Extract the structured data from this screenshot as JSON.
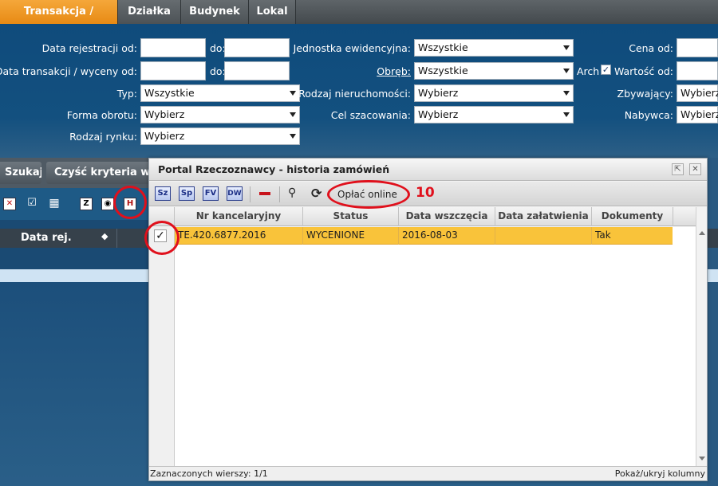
{
  "tabs": [
    {
      "label": "Transakcja / Wycena",
      "active": true
    },
    {
      "label": "Działka",
      "active": false
    },
    {
      "label": "Budynek",
      "active": false
    },
    {
      "label": "Lokal",
      "active": false
    }
  ],
  "filters": {
    "data_rej_od": "Data rejestracji od:",
    "do1": "do:",
    "data_trans_od": "Data transakcji / wyceny od:",
    "do2": "do:",
    "typ": "Typ:",
    "typ_value": "Wszystkie",
    "forma_obrotu": "Forma obrotu:",
    "forma_obrotu_value": "Wybierz",
    "rodzaj_rynku": "Rodzaj rynku:",
    "rodzaj_rynku_value": "Wybierz",
    "jednostka": "Jednostka ewidencyjna:",
    "jednostka_value": "Wszystkie",
    "obreb": "Obręb:",
    "obreb_value": "Wszystkie",
    "arch": "Arch",
    "rodzaj_nier": "Rodzaj nieruchomości:",
    "rodzaj_nier_value": "Wybierz",
    "cel": "Cel szacowania:",
    "cel_value": "Wybierz",
    "cena_od": "Cena od:",
    "wartosc_od": "Wartość od:",
    "zbywajacy": "Zbywający:",
    "zbywajacy_value": "Wybierz",
    "nabywca": "Nabywca:",
    "nabywca_value": "Wybierz"
  },
  "buttons": {
    "szukaj": "Szukaj",
    "czysc": "Czyść kryteria wys"
  },
  "mini_icons": {
    "z": "Z",
    "h": "H"
  },
  "grid": {
    "col_data_rej": "Data rej."
  },
  "modal": {
    "title": "Portal Rzeczoznawcy - historia zamówień",
    "toolbar": {
      "sz": "Sz",
      "sp": "Sp",
      "fv": "FV",
      "dw": "DW",
      "pay_online": "Opłać online"
    },
    "annotation_number": "10",
    "columns": [
      "Nr kancelaryjny",
      "Status",
      "Data wszczęcia",
      "Data załatwienia",
      "Dokumenty"
    ],
    "rows": [
      {
        "nr": "TE.420.6877.2016",
        "status": "WYCENIONE",
        "data_wszczecia": "2016-08-03",
        "data_zalatwienia": "",
        "dokumenty": "Tak",
        "checked": true
      }
    ],
    "status_left": "Zaznaczonych wierszy: 1/1",
    "status_right": "Pokaż/ukryj kolumny"
  },
  "colors": {
    "accent_tab": "#e78a14",
    "selected_row": "#f9c33a",
    "annotation": "#e0101c"
  }
}
